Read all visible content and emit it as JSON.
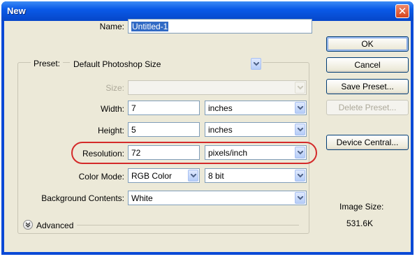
{
  "window": {
    "title": "New",
    "close_glyph": "✕"
  },
  "name": {
    "label": "Name:",
    "value": "Untitled-1"
  },
  "preset": {
    "label": "Preset:",
    "value": "Default Photoshop Size"
  },
  "size": {
    "label": "Size:",
    "value": ""
  },
  "width": {
    "label": "Width:",
    "value": "7",
    "unit": "inches"
  },
  "height": {
    "label": "Height:",
    "value": "5",
    "unit": "inches"
  },
  "resolution": {
    "label": "Resolution:",
    "value": "72",
    "unit": "pixels/inch"
  },
  "color_mode": {
    "label": "Color Mode:",
    "mode": "RGB Color",
    "depth": "8 bit"
  },
  "background": {
    "label": "Background Contents:",
    "value": "White"
  },
  "advanced": {
    "label": "Advanced"
  },
  "buttons": {
    "ok": "OK",
    "cancel": "Cancel",
    "save_preset": "Save Preset...",
    "delete_preset": "Delete Preset...",
    "device_central": "Device Central..."
  },
  "image_size": {
    "label": "Image Size:",
    "value": "531.6K"
  },
  "annotation": {
    "highlight_color": "#d42a2a"
  },
  "icons": {
    "dropdown": "chevron-down-icon",
    "advanced": "double-chevron-down-icon"
  }
}
